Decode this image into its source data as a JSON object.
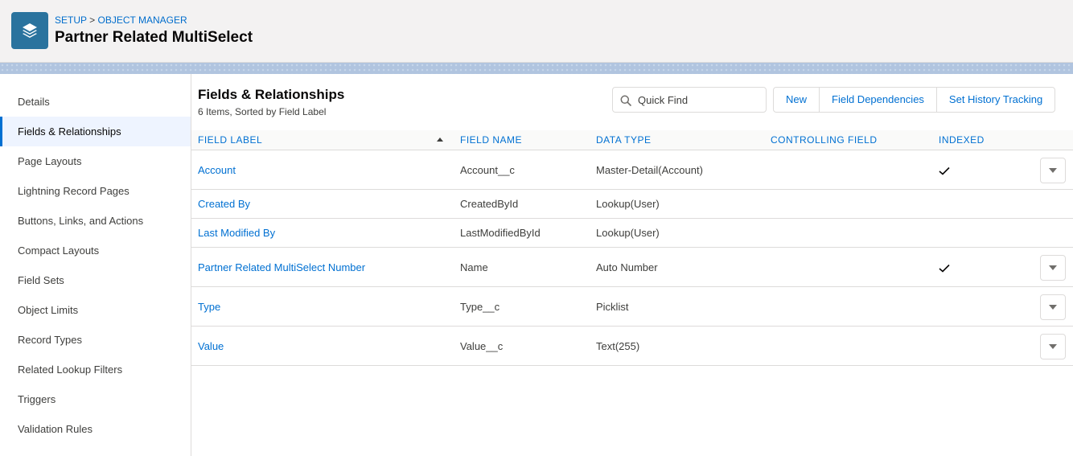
{
  "header": {
    "breadcrumb": {
      "setup": "SETUP",
      "separator": ">",
      "object_manager": "OBJECT MANAGER"
    },
    "title": "Partner Related MultiSelect",
    "icon": "layers-icon"
  },
  "sidebar": {
    "items": [
      {
        "label": "Details"
      },
      {
        "label": "Fields & Relationships"
      },
      {
        "label": "Page Layouts"
      },
      {
        "label": "Lightning Record Pages"
      },
      {
        "label": "Buttons, Links, and Actions"
      },
      {
        "label": "Compact Layouts"
      },
      {
        "label": "Field Sets"
      },
      {
        "label": "Object Limits"
      },
      {
        "label": "Record Types"
      },
      {
        "label": "Related Lookup Filters"
      },
      {
        "label": "Triggers"
      },
      {
        "label": "Validation Rules"
      }
    ],
    "active_index": 1
  },
  "main": {
    "title": "Fields & Relationships",
    "subtitle": "6 Items, Sorted by Field Label",
    "search": {
      "placeholder": "Quick Find",
      "value": ""
    },
    "buttons": {
      "new": "New",
      "field_dependencies": "Field Dependencies",
      "history_tracking": "Set History Tracking"
    },
    "columns": {
      "field_label": "FIELD LABEL",
      "field_name": "FIELD NAME",
      "data_type": "DATA TYPE",
      "controlling_field": "CONTROLLING FIELD",
      "indexed": "INDEXED"
    },
    "rows": [
      {
        "label": "Account",
        "name": "Account__c",
        "type": "Master-Detail(Account)",
        "controlling": "",
        "indexed": true,
        "menu": true
      },
      {
        "label": "Created By",
        "name": "CreatedById",
        "type": "Lookup(User)",
        "controlling": "",
        "indexed": false,
        "menu": false
      },
      {
        "label": "Last Modified By",
        "name": "LastModifiedById",
        "type": "Lookup(User)",
        "controlling": "",
        "indexed": false,
        "menu": false
      },
      {
        "label": "Partner Related MultiSelect Number",
        "name": "Name",
        "type": "Auto Number",
        "controlling": "",
        "indexed": true,
        "menu": true
      },
      {
        "label": "Type",
        "name": "Type__c",
        "type": "Picklist",
        "controlling": "",
        "indexed": false,
        "menu": true
      },
      {
        "label": "Value",
        "name": "Value__c",
        "type": "Text(255)",
        "controlling": "",
        "indexed": false,
        "menu": true
      }
    ]
  },
  "colors": {
    "brand": "#0070d2",
    "icon_bg": "#2a739e",
    "header_bg": "#f3f2f2",
    "active_bg": "#eef4ff"
  }
}
